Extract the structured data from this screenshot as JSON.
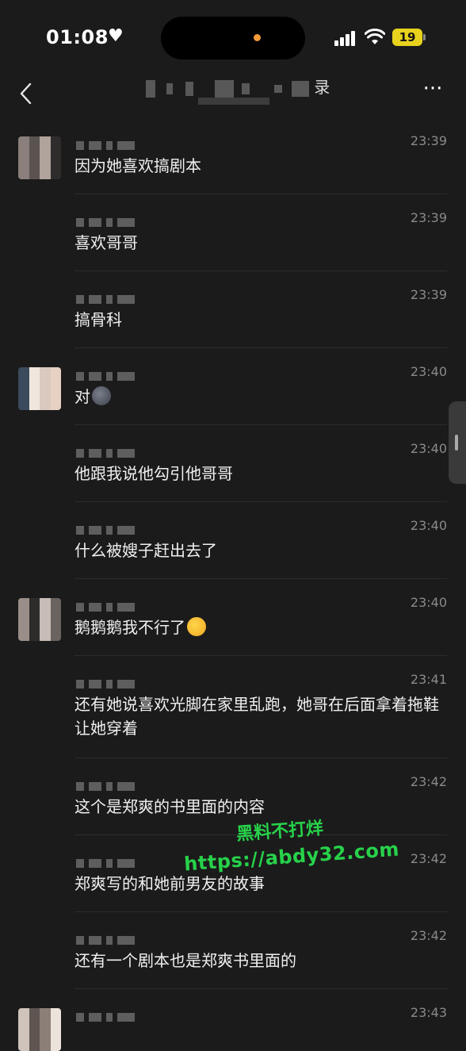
{
  "status_bar": {
    "time": "01:08",
    "heart": "♥",
    "battery": "19"
  },
  "header": {
    "title_visible": "录",
    "back_icon": "chevron-left-icon",
    "more_label": "···"
  },
  "messages": [
    {
      "time": "23:39",
      "text": "因为她喜欢搞剧本",
      "show_avatar": true
    },
    {
      "time": "23:39",
      "text": "喜欢哥哥",
      "show_avatar": false
    },
    {
      "time": "23:39",
      "text": "搞骨科",
      "show_avatar": false
    },
    {
      "time": "23:40",
      "text": "对",
      "show_avatar": true,
      "emoji": "new-moon-face"
    },
    {
      "time": "23:40",
      "text": "他跟我说他勾引他哥哥",
      "show_avatar": false
    },
    {
      "time": "23:40",
      "text": "什么被嫂子赶出去了",
      "show_avatar": false
    },
    {
      "time": "23:40",
      "text": "鹅鹅鹅我不行了",
      "show_avatar": true,
      "emoji": "laughing-face"
    },
    {
      "time": "23:41",
      "text": "还有她说喜欢光脚在家里乱跑，她哥在后面拿着拖鞋让她穿着",
      "show_avatar": false
    },
    {
      "time": "23:42",
      "text": "这个是郑爽的书里面的内容",
      "show_avatar": false
    },
    {
      "time": "23:42",
      "text": "郑爽写的和她前男友的故事",
      "show_avatar": false
    },
    {
      "time": "23:42",
      "text": "还有一个剧本也是郑爽书里面的",
      "show_avatar": false
    },
    {
      "time": "23:43",
      "text": "",
      "show_avatar": true
    }
  ],
  "watermark": {
    "line1": "黑料不打烊",
    "line2": "https://abdy32.com"
  },
  "colors": {
    "background": "#1b1b1b",
    "text": "#f0f0f0",
    "timestamp": "#8a8a8a",
    "watermark": "#27d24a",
    "battery": "#e8d21d"
  }
}
